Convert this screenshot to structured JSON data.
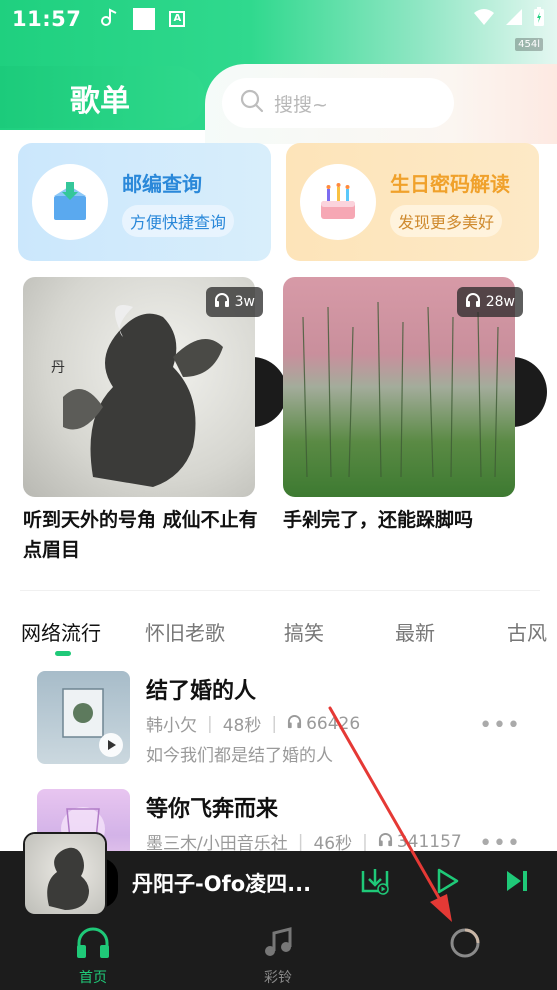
{
  "status_bar": {
    "time": "11:57",
    "net_speed": "454l"
  },
  "header": {
    "title": "歌单",
    "search_placeholder": "搜搜~"
  },
  "feature_cards": [
    {
      "title": "邮编查询",
      "subtitle": "方便快捷查询",
      "icon": "mailbox-icon"
    },
    {
      "title": "生日密码解读",
      "subtitle": "发现更多美好",
      "icon": "birthday-cake-icon"
    }
  ],
  "playlists": [
    {
      "title": "听到天外的号角 成仙不止有点眉目",
      "plays": "3w"
    },
    {
      "title": "手剁完了，还能跺脚吗",
      "plays": "28w"
    }
  ],
  "categories": [
    "网络流行",
    "怀旧老歌",
    "搞笑",
    "最新",
    "古风"
  ],
  "active_category": "网络流行",
  "songs": [
    {
      "title": "结了婚的人",
      "artist": "韩小欠",
      "duration": "48秒",
      "plays": "66426",
      "desc": "如今我们都是结了婚的人"
    },
    {
      "title": "等你飞奔而来",
      "artist": "墨三木/小田音乐社",
      "duration": "46秒",
      "plays": "341157",
      "desc": ""
    }
  ],
  "player": {
    "title": "丹阳子-Ofo凌四..."
  },
  "bottom_nav": [
    {
      "label": "首页",
      "icon": "headphones-icon",
      "active": true
    },
    {
      "label": "彩铃",
      "icon": "music-note-icon",
      "active": false
    },
    {
      "label": "",
      "icon": "loading-ring-icon",
      "active": false
    }
  ],
  "colors": {
    "accent": "#1fc978",
    "annotation": "#e53935"
  }
}
